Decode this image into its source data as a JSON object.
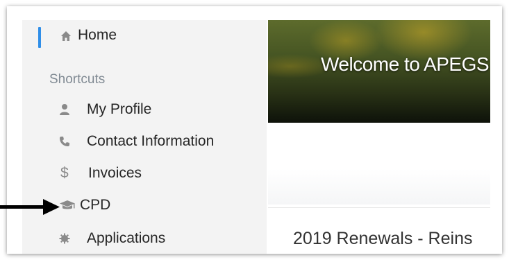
{
  "sidebar": {
    "home_label": "Home",
    "section_title": "Shortcuts",
    "items": [
      {
        "label": "My Profile",
        "icon": "user-icon",
        "glyph": ""
      },
      {
        "label": "Contact Information",
        "icon": "phone-icon",
        "glyph": ""
      },
      {
        "label": "Invoices",
        "icon": "dollar-icon",
        "glyph": "$"
      },
      {
        "label": "CPD",
        "icon": "graduation-cap-icon",
        "glyph": ""
      },
      {
        "label": "Applications",
        "icon": "gear-icon",
        "glyph": ""
      }
    ]
  },
  "banner": {
    "title": "Welcome to APEGS"
  },
  "card": {
    "title": "2019 Renewals - Reins"
  },
  "colors": {
    "active_indicator": "#2f8ee8",
    "sidebar_bg": "#f3f3f3",
    "section_title": "#808a93",
    "icon": "#8a8a8a"
  }
}
